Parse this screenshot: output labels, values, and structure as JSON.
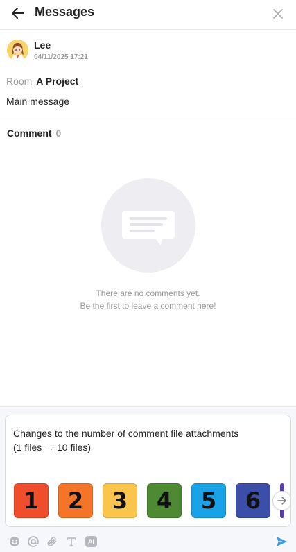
{
  "header": {
    "title": "Messages",
    "back_icon": "arrow-left-icon",
    "close_icon": "close-icon"
  },
  "post": {
    "author": "Lee",
    "timestamp": "04/11/2025 17:21",
    "room_label": "Room",
    "room_name": "A Project",
    "message": "Main message"
  },
  "comments": {
    "label": "Comment",
    "count": "0",
    "empty_line1": "There are no comments yet.",
    "empty_line2": "Be the first to leave a comment here!"
  },
  "composer": {
    "text": "Changes to the number of comment file attachments\n(1 files → 10 files)",
    "attachments": [
      {
        "label": "1",
        "color": "#f04e2b"
      },
      {
        "label": "2",
        "color": "#f47527"
      },
      {
        "label": "3",
        "color": "#fbc44c"
      },
      {
        "label": "4",
        "color": "#4e8a31"
      },
      {
        "label": "5",
        "color": "#1aa2e8"
      },
      {
        "label": "6",
        "color": "#3a4eaa"
      }
    ]
  },
  "toolbar": {
    "icons": [
      "emoji-icon",
      "mention-icon",
      "attachment-icon",
      "text-format-icon",
      "ai-icon"
    ],
    "ai_label": "AI",
    "send_icon": "send-icon",
    "accent": "#3a9de0"
  }
}
